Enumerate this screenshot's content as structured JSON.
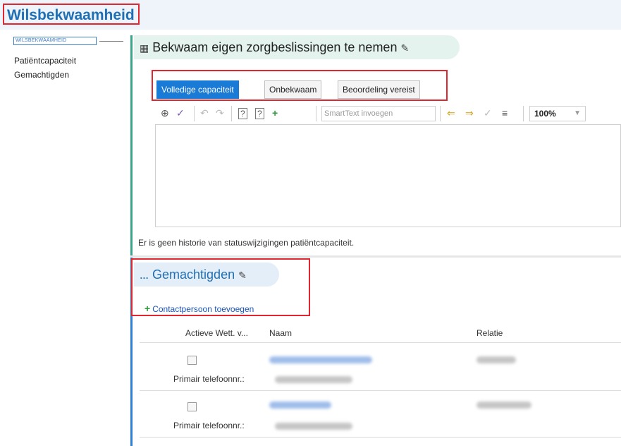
{
  "header": {
    "title": "Wilsbekwaamheid"
  },
  "nav": {
    "active_item": "WILSBEKWAAMHEID",
    "items": [
      "Patiëntcapaciteit",
      "Gemachtigden"
    ]
  },
  "section1": {
    "title": "Bekwaam eigen zorgbeslissingen te nemen",
    "tabs": [
      "Volledige capaciteit",
      "Onbekwaam",
      "Beoordeling vereist"
    ],
    "active_tab_index": 0,
    "toolbar": {
      "smarttext_placeholder": "SmartText invoegen",
      "zoom": "100%"
    },
    "history_text": "Er is geen historie van statuswijzigingen patiëntcapaciteit."
  },
  "section2": {
    "title": "Gemachtigden",
    "add_contact_label": "Contactpersoon toevoegen",
    "columns": [
      "Actieve Wett. v...",
      "Naam",
      "Relatie"
    ],
    "rows": [
      {
        "phone_label": "Primair telefoonnr.:"
      },
      {
        "phone_label": "Primair telefoonnr.:"
      }
    ]
  },
  "colors": {
    "accent_blue": "#1a7bd6",
    "title_blue": "#1f6fb5",
    "section1_green": "#3aa58a",
    "highlight_red": "#e0262f"
  }
}
